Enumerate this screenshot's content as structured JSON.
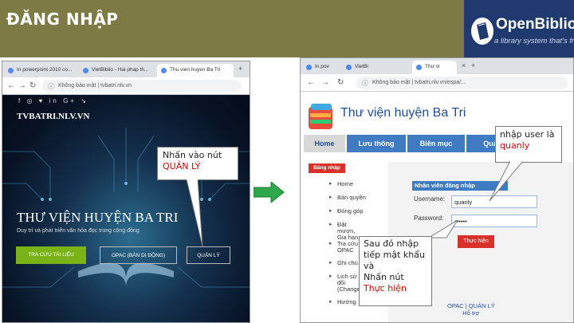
{
  "slide": {
    "title": "ĐĂNG NHẬP",
    "logo_name": "OpenBiblio",
    "logo_tagline": "a library system that's free"
  },
  "left_browser": {
    "tabs": [
      "In powerpoint 2010 co...",
      "VietBiblio - Hai phap th...",
      "Thu vien huyen Ba Tri"
    ],
    "address": "Không bảo mật | tvbatri.nlv.vn",
    "social": "f ◎ ♥ in G+ ↘",
    "site_domain": "TVBATRI.NLV.VN",
    "site_name": "THƯ VIỆN HUYỆN BA TRI",
    "site_slogan": "Duy trì và phát triển văn hóa đọc trong cộng đồng",
    "btn_search": "TRA CỨU TÀI LIỆU",
    "btn_opac": "OPAC (BẢN DI ĐỘNG)",
    "btn_admin": "QUẢN LÝ"
  },
  "callout_left": {
    "line1": "Nhấn vào nút",
    "line2": "QUẢN LÝ"
  },
  "right_browser": {
    "tabs": [
      "In pov",
      "VietBi",
      "Thư vi"
    ],
    "address": "Không bảo mật | tvbatri.nlv.vn/espa/...",
    "library_title": "Thư viện huyện Ba Tri",
    "menu": [
      "Home",
      "Lưu thông",
      "Biên mục",
      "Quả"
    ],
    "login_badge": "Đăng nhập",
    "sidebar": [
      "Home",
      "Bản quyền",
      "Đóng góp",
      "Đặt mượn, Gia hạn",
      "Tra cứu OPAC",
      "Ghi chú",
      "Lịch sử đổi (Change",
      "Hướng"
    ],
    "panel_title": "Nhân viên đăng nhập",
    "username_label": "Username:",
    "username_value": "quanly",
    "password_label": "Password:",
    "password_value": "••••••",
    "submit_label": "Thực hiện",
    "footer_line1": "OPAC | QUẢN LÝ",
    "footer_line2": "Hỗ trợ"
  },
  "callout_user": {
    "line1": "nhập user là",
    "line2": "quanly"
  },
  "callout_pass": {
    "lines": [
      "Sau đó nhập",
      "tiếp mật khẩu",
      "và",
      "Nhấn nút"
    ],
    "red": "Thực hiện"
  },
  "colors": {
    "header_bg": "#7e7a45",
    "logo_bg": "#1e3a6e",
    "accent_blue": "#3e7bc2",
    "accent_red": "#d9302a",
    "arrow_green": "#2ea84a"
  }
}
